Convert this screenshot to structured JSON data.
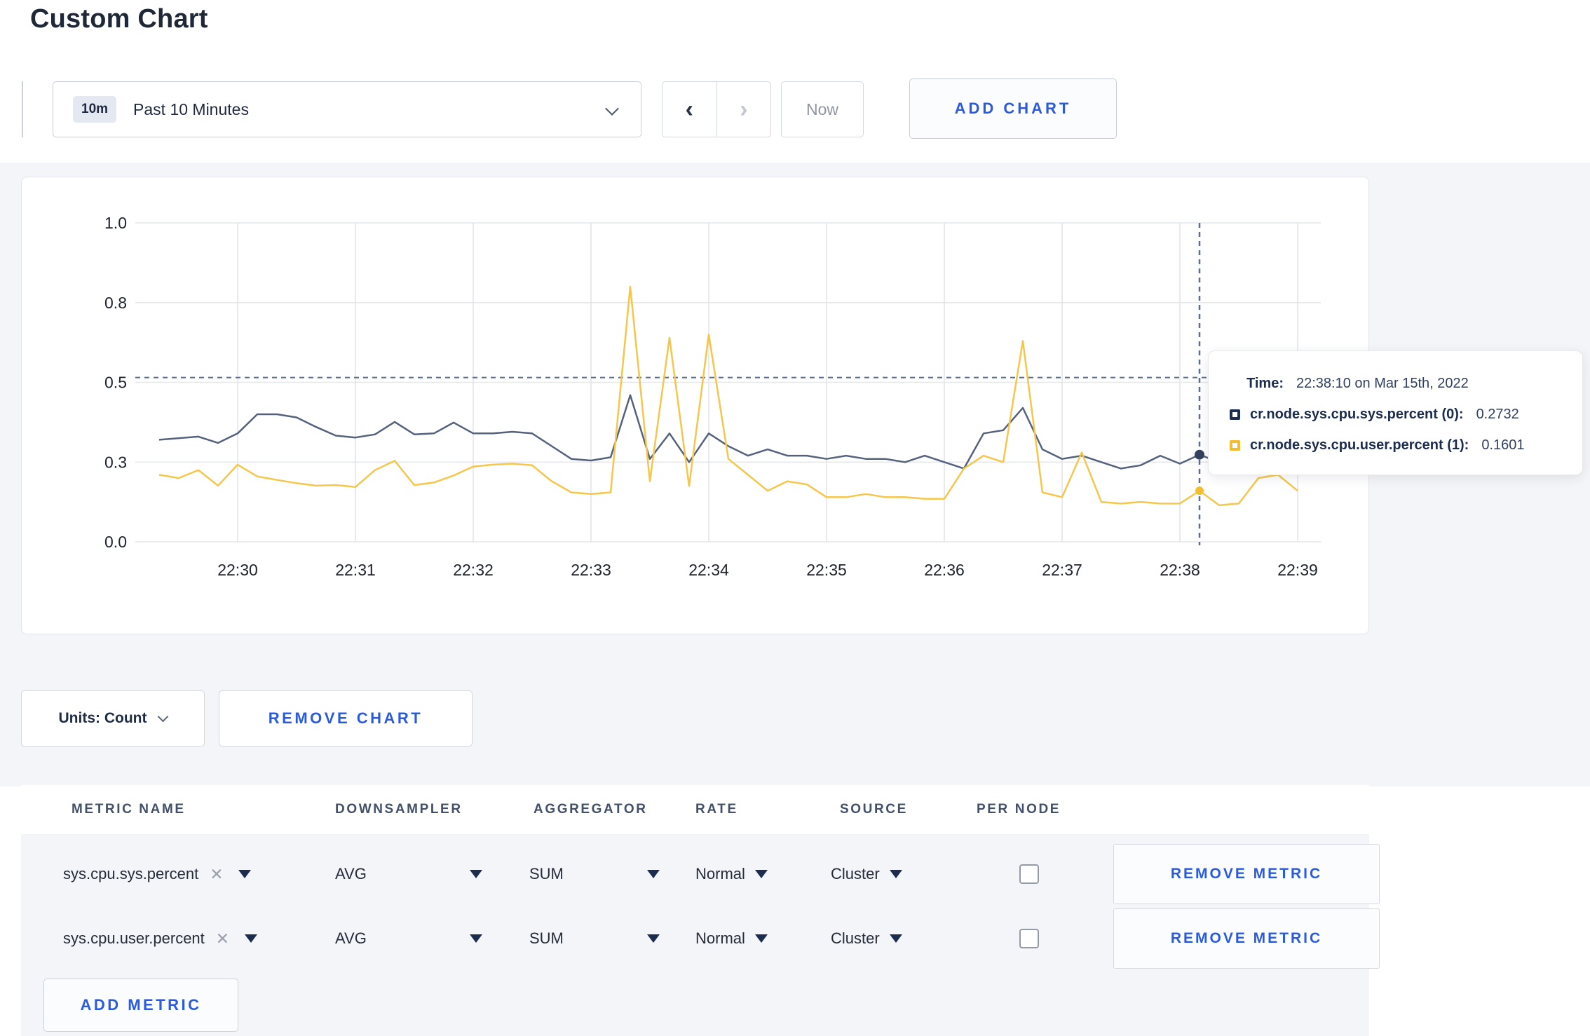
{
  "page": {
    "title": "Custom Chart"
  },
  "toolbar": {
    "time_window_badge": "10m",
    "time_window_label": "Past 10 Minutes",
    "prev_glyph": "‹",
    "next_glyph": "›",
    "now_label": "Now",
    "add_chart_label": "ADD CHART"
  },
  "chart_data": {
    "type": "line",
    "title": "",
    "xlabel": "",
    "ylabel": "",
    "ylim": [
      0,
      1
    ],
    "grid": true,
    "y_tick_labels": [
      "0.0",
      "0.3",
      "0.5",
      "0.8",
      "1.0"
    ],
    "y_tick_values": [
      0,
      0.25,
      0.5,
      0.75,
      1.0
    ],
    "x_ticks": [
      "22:30",
      "22:31",
      "22:32",
      "22:33",
      "22:34",
      "22:35",
      "22:36",
      "22:37",
      "22:38",
      "22:39"
    ],
    "x_start": "22:29:20",
    "x_step_seconds": 10,
    "series": [
      {
        "name": "cr.node.sys.cpu.sys.percent (0)",
        "color": "#55627d",
        "dot_color": "#33415c",
        "values": [
          0.32,
          0.325,
          0.33,
          0.31,
          0.34,
          0.4,
          0.4,
          0.39,
          0.36,
          0.333,
          0.327,
          0.337,
          0.376,
          0.337,
          0.34,
          0.374,
          0.34,
          0.34,
          0.345,
          0.34,
          0.3,
          0.26,
          0.255,
          0.265,
          0.46,
          0.26,
          0.34,
          0.25,
          0.34,
          0.3,
          0.27,
          0.29,
          0.27,
          0.27,
          0.26,
          0.27,
          0.26,
          0.26,
          0.25,
          0.27,
          0.25,
          0.23,
          0.34,
          0.35,
          0.42,
          0.29,
          0.26,
          0.27,
          0.25,
          0.23,
          0.24,
          0.27,
          0.245,
          0.2732,
          0.25,
          0.26,
          0.26,
          0.27,
          0.27
        ]
      },
      {
        "name": "cr.node.sys.cpu.user.percent (1)",
        "color": "#f6c64b",
        "dot_color": "#f2be2c",
        "values": [
          0.21,
          0.2,
          0.225,
          0.176,
          0.242,
          0.205,
          0.194,
          0.184,
          0.176,
          0.178,
          0.172,
          0.225,
          0.254,
          0.178,
          0.186,
          0.208,
          0.236,
          0.242,
          0.245,
          0.24,
          0.19,
          0.155,
          0.15,
          0.155,
          0.8,
          0.19,
          0.64,
          0.175,
          0.65,
          0.26,
          0.21,
          0.16,
          0.19,
          0.18,
          0.14,
          0.14,
          0.15,
          0.14,
          0.14,
          0.135,
          0.135,
          0.23,
          0.27,
          0.25,
          0.63,
          0.155,
          0.14,
          0.28,
          0.125,
          0.12,
          0.125,
          0.12,
          0.12,
          0.1601,
          0.115,
          0.12,
          0.2,
          0.21,
          0.16
        ]
      }
    ],
    "crosshair": {
      "time": "22:38:10",
      "index": 53,
      "y_value": 0.515,
      "sys_value": 0.2732,
      "user_value": 0.1601
    },
    "legend_position": "tooltip"
  },
  "tooltip": {
    "time_label": "Time:",
    "time_value": "22:38:10 on Mar 15th, 2022",
    "series": [
      {
        "label": "cr.node.sys.cpu.sys.percent (0):",
        "value": "0.2732",
        "color": "#1c2c4f"
      },
      {
        "label": "cr.node.sys.cpu.user.percent (1):",
        "value": "0.1601",
        "color": "#f2be2c"
      }
    ]
  },
  "chart_footer": {
    "units_label": "Units: Count",
    "remove_chart_label": "REMOVE CHART"
  },
  "metrics_table": {
    "headers": [
      "METRIC NAME",
      "DOWNSAMPLER",
      "AGGREGATOR",
      "RATE",
      "SOURCE",
      "PER NODE"
    ],
    "header_x": [
      72,
      448,
      731,
      962,
      1168,
      1363
    ],
    "rows": [
      {
        "metric": "sys.cpu.sys.percent",
        "remove_glyph": "✕",
        "downsampler": "AVG",
        "aggregator": "SUM",
        "rate": "Normal",
        "source": "Cluster",
        "per_node": false,
        "remove_label": "REMOVE METRIC"
      },
      {
        "metric": "sys.cpu.user.percent",
        "remove_glyph": "✕",
        "downsampler": "AVG",
        "aggregator": "SUM",
        "rate": "Normal",
        "source": "Cluster",
        "per_node": false,
        "remove_label": "REMOVE METRIC"
      }
    ],
    "add_metric_label": "ADD METRIC"
  },
  "colors": {
    "accent_blue": "#2a5ae0",
    "navy_text": "#1f2940",
    "grid_line": "#e6e7ec",
    "crosshair": "#5d6e8c",
    "band_bg": "#f4f5f8"
  }
}
